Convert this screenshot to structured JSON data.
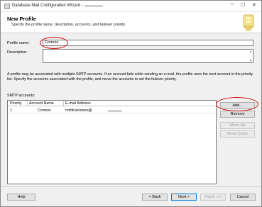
{
  "window": {
    "title": "Database Mail Configuration Wizard -"
  },
  "header": {
    "title": "New Profile",
    "subtitle": "Specify the profile name, description, accounts, and failover priority."
  },
  "profile": {
    "name_label": "Profile name:",
    "name_value": "Correos",
    "description_label": "Description:",
    "description_value": ""
  },
  "info_text": "A profile may be associated with multiple SMTP accounts. If an account fails while sending an e-mail, the profile uses the next account in the priority list. Specify the accounts associated with the profile, and move the accounts to set the failover priority.",
  "smtp": {
    "label": "SMTP accounts:",
    "columns": [
      "Priority",
      "Account Name",
      "E-mail Address"
    ],
    "rows": [
      {
        "priority": "1",
        "account_name": "Correos",
        "email": "notificaciones@"
      }
    ]
  },
  "side_buttons": {
    "add": "Add...",
    "remove": "Remove",
    "move_up": "Move Up",
    "move_down": "Move Down"
  },
  "footer": {
    "help": "Help",
    "back": "< Back",
    "next": "Next >",
    "finish": "Finish >>|",
    "cancel": "Cancel"
  },
  "colors": {
    "annotation": "#d01010",
    "focus_border": "#0078d7"
  }
}
